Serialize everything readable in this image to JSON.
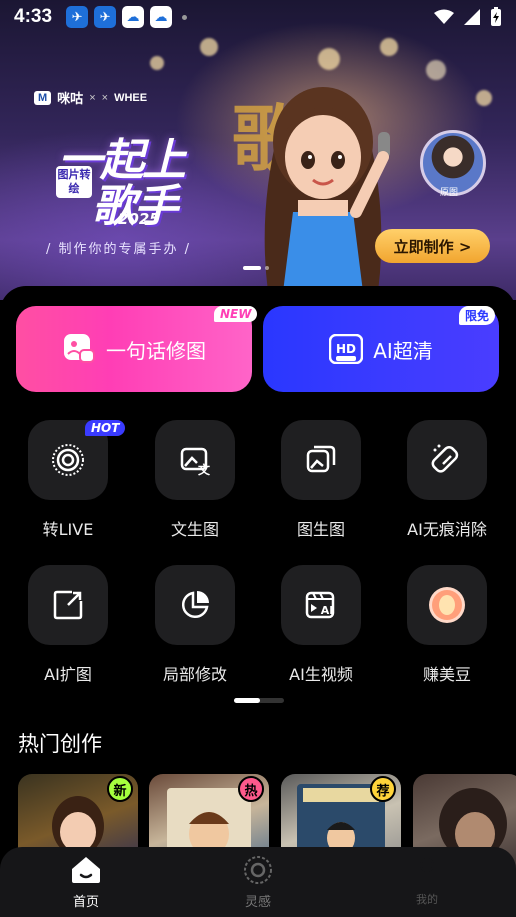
{
  "status_bar": {
    "time": "4:33"
  },
  "banner": {
    "partner_brand": "咪咕",
    "partner_times": "×",
    "partner_whee": "WHEE",
    "slogan_line1": "一起上",
    "slogan_line2": "歌手",
    "slogan_tag": "图片转绘",
    "slogan_year": "2025",
    "slogan_sub": "/ 制作你的专属手办 /",
    "cta": "立即制作 >",
    "avatar_label": "原图"
  },
  "feature_buttons": {
    "left": {
      "label": "一句话修图",
      "badge": "NEW",
      "icon": "photo-chat-icon"
    },
    "right": {
      "label": "AI超清",
      "badge": "限免",
      "icon": "hd-ultra-icon"
    }
  },
  "tools_row1": [
    {
      "label": "转LIVE",
      "icon": "live-photo-icon",
      "badge": "HOT"
    },
    {
      "label": "文生图",
      "icon": "text-to-image-icon"
    },
    {
      "label": "图生图",
      "icon": "image-to-image-icon"
    },
    {
      "label": "AI无痕消除",
      "icon": "eraser-icon"
    }
  ],
  "tools_row2": [
    {
      "label": "AI扩图",
      "icon": "expand-image-icon"
    },
    {
      "label": "局部修改",
      "icon": "partial-edit-icon"
    },
    {
      "label": "AI生视频",
      "icon": "ai-video-icon"
    },
    {
      "label": "赚美豆",
      "icon": "bean-coin-icon"
    }
  ],
  "section": {
    "title": "热门创作"
  },
  "cards": [
    {
      "badge": "新",
      "badge_color": "#a6ff3e"
    },
    {
      "badge": "热",
      "badge_color": "#ff5a8c"
    },
    {
      "badge": "荐",
      "badge_color": "#ffd43a"
    },
    {
      "badge": ""
    }
  ],
  "bottom_nav": [
    {
      "label": "首页",
      "icon": "home-icon",
      "active": true
    },
    {
      "label": "灵感",
      "icon": "inspiration-icon",
      "active": false
    },
    {
      "label": "我的",
      "icon": "profile-icon",
      "active": false
    }
  ]
}
